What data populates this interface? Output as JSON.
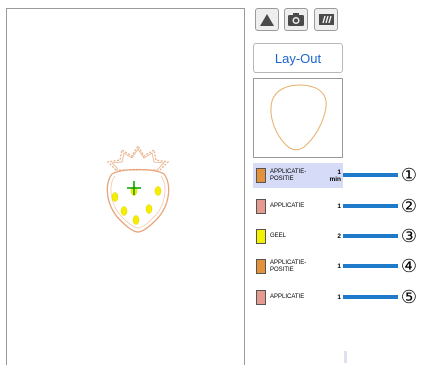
{
  "toolbar": {
    "buttons": [
      {
        "name": "triangle-icon"
      },
      {
        "name": "camera-icon"
      },
      {
        "name": "fabric-icon"
      }
    ],
    "layout_label": "Lay-Out"
  },
  "thread_list": [
    {
      "name": "APPLICATIE-\nPOSITIE",
      "count": "1",
      "time": "min",
      "color": "#e3913a",
      "selected": true,
      "callout": "①"
    },
    {
      "name": "APPLICATIE",
      "count": "1",
      "time": "",
      "color": "#e59a90",
      "selected": false,
      "callout": "②"
    },
    {
      "name": "GEEL",
      "count": "2",
      "time": "",
      "color": "#f2f200",
      "selected": false,
      "callout": "③"
    },
    {
      "name": "APPLICATIE-\nPOSITIE",
      "count": "1",
      "time": "",
      "color": "#e3913a",
      "selected": false,
      "callout": "④"
    },
    {
      "name": "APPLICATIE",
      "count": "1",
      "time": "",
      "color": "#e59a90",
      "selected": false,
      "callout": "⑤"
    }
  ],
  "colors": {
    "accent_blue": "#1f7ac9",
    "selected_row": "#d6dcf8",
    "outline_orange": "#e8b078",
    "seed_yellow": "#f5ee00",
    "cursor_green": "#00a000"
  }
}
